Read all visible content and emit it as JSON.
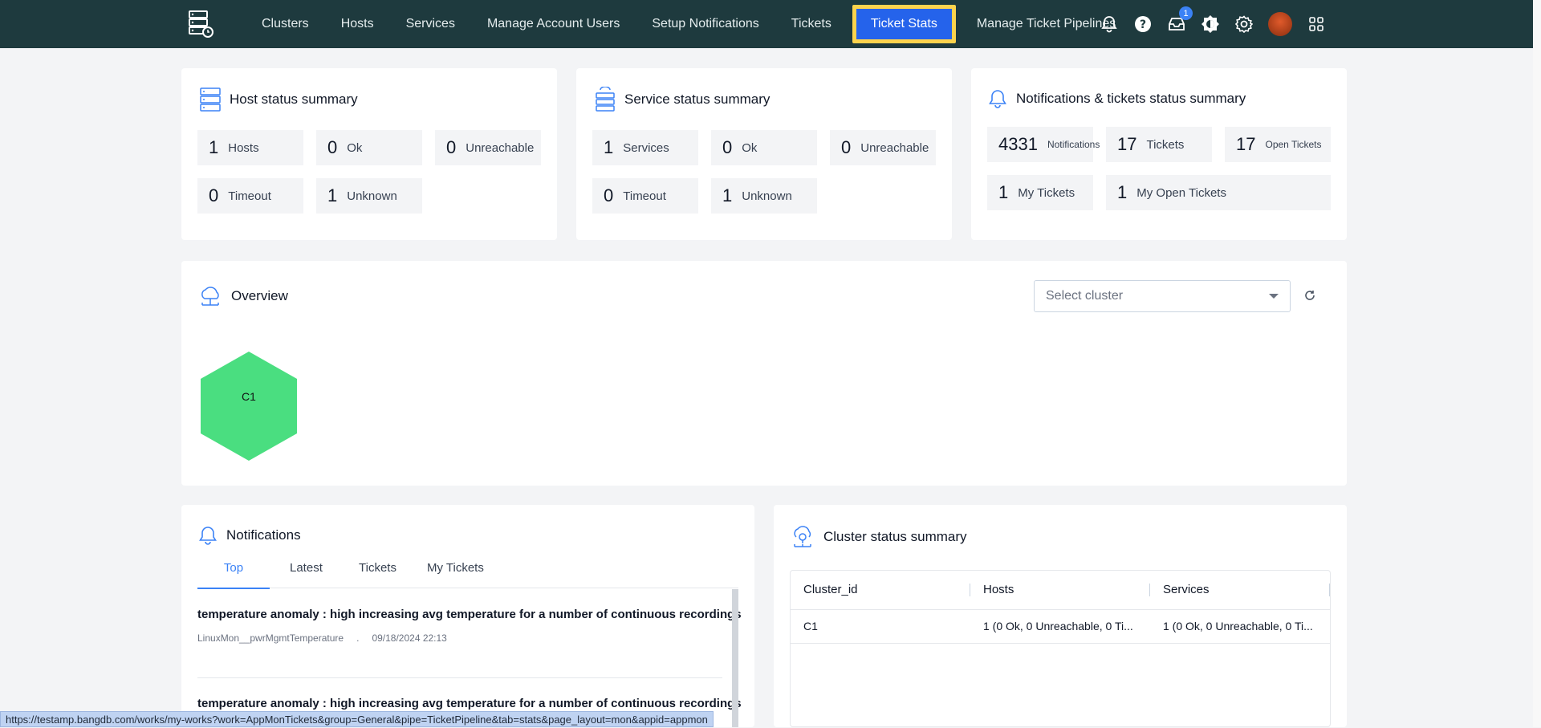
{
  "nav": {
    "items": [
      "Clusters",
      "Hosts",
      "Services",
      "Manage Account Users",
      "Setup Notifications",
      "Tickets",
      "Ticket Stats",
      "Manage Ticket Pipelines"
    ],
    "active": "Ticket Stats",
    "inbox_badge": "1",
    "icons": [
      "server-logo-icon",
      "bell-icon",
      "help-icon",
      "inbox-icon",
      "theme-icon",
      "gear-icon",
      "avatar",
      "apps-grid-icon"
    ]
  },
  "host_summary": {
    "title": "Host status summary",
    "tiles": [
      {
        "num": "1",
        "label": "Hosts"
      },
      {
        "num": "0",
        "label": "Ok"
      },
      {
        "num": "0",
        "label": "Unreachable"
      },
      {
        "num": "0",
        "label": "Timeout"
      },
      {
        "num": "1",
        "label": "Unknown"
      }
    ]
  },
  "service_summary": {
    "title": "Service status summary",
    "tiles": [
      {
        "num": "1",
        "label": "Services"
      },
      {
        "num": "0",
        "label": "Ok"
      },
      {
        "num": "0",
        "label": "Unreachable"
      },
      {
        "num": "0",
        "label": "Timeout"
      },
      {
        "num": "1",
        "label": "Unknown"
      }
    ]
  },
  "notif_summary": {
    "title": "Notifications & tickets status summary",
    "tiles": [
      {
        "num": "4331",
        "label": "Notifications"
      },
      {
        "num": "17",
        "label": "Tickets"
      },
      {
        "num": "17",
        "label": "Open Tickets"
      },
      {
        "num": "1",
        "label": "My Tickets"
      },
      {
        "num": "1",
        "label": "My Open Tickets"
      }
    ]
  },
  "overview": {
    "title": "Overview",
    "select_placeholder": "Select cluster",
    "clusters": [
      {
        "id": "C1",
        "color": "#4ade80"
      }
    ]
  },
  "notifications": {
    "title": "Notifications",
    "tabs": [
      "Top",
      "Latest",
      "Tickets",
      "My Tickets"
    ],
    "active_tab": "Top",
    "items": [
      {
        "title": "temperature anomaly : high increasing avg temperature for a number of continuous recordings",
        "source": "LinuxMon__pwrMgmtTemperature",
        "time": "09/18/2024 22:13"
      },
      {
        "title": "temperature anomaly : high increasing avg temperature for a number of continuous recordings",
        "source": "",
        "time": ""
      }
    ]
  },
  "cluster_status": {
    "title": "Cluster status summary",
    "columns": [
      "Cluster_id",
      "Hosts",
      "Services"
    ],
    "rows": [
      [
        "C1",
        "1 (0 Ok, 0 Unreachable, 0 Ti...",
        "1 (0 Ok, 0 Unreachable, 0 Ti..."
      ]
    ]
  },
  "status_url": "https://testamp.bangdb.com/works/my-works?work=AppMonTickets&group=General&pipe=TicketPipeline&tab=stats&page_layout=mon&appid=appmon",
  "colors": {
    "nav_bg": "#1e3a3e",
    "accent": "#2563eb",
    "highlight": "#fcd34d",
    "cluster": "#4ade80"
  }
}
